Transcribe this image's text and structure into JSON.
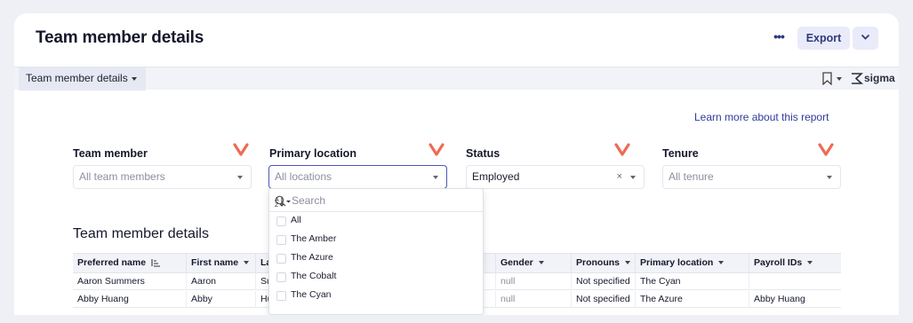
{
  "header": {
    "title": "Team member details",
    "more_label": "•••",
    "export_label": "Export"
  },
  "tabbar": {
    "tab_label": "Team member details",
    "brand": "sigma"
  },
  "learn_more": "Learn more about this report",
  "filters": [
    {
      "label": "Team member",
      "value": "All team members"
    },
    {
      "label": "Primary location",
      "value": "All locations"
    },
    {
      "label": "Status",
      "value": "Employed",
      "clear": "×"
    },
    {
      "label": "Tenure",
      "value": "All tenure"
    }
  ],
  "accent_colors": {
    "chevron": "#f06a55",
    "link": "#2e3b9a",
    "active_border": "#4a57b8"
  },
  "dropdown": {
    "search_placeholder": "Search",
    "options": [
      "All",
      "The Amber",
      "The Azure",
      "The Cobalt",
      "The Cyan"
    ]
  },
  "table": {
    "title": "Team member details",
    "columns": [
      "Preferred name",
      "First name",
      "La",
      "Gender",
      "Pronouns",
      "Primary location",
      "Payroll IDs"
    ],
    "rows": [
      [
        "Aaron Summers",
        "Aaron",
        "Su",
        "null",
        "Not specified",
        "The Cyan",
        ""
      ],
      [
        "Abby Huang",
        "Abby",
        "Hu",
        "null",
        "Not specified",
        "The Azure",
        "Abby Huang"
      ]
    ]
  }
}
